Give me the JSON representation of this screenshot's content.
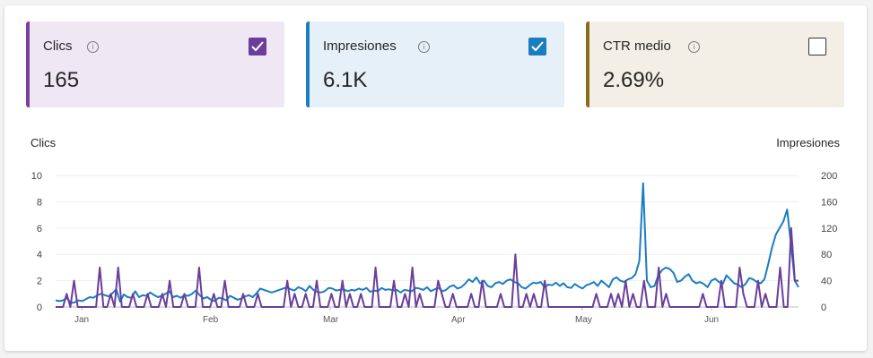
{
  "cards": [
    {
      "label": "Clics",
      "value": "165",
      "checked": true,
      "accent": "#7b3f9e",
      "bg": "#efe7f4",
      "check_color": "#6a3e9a"
    },
    {
      "label": "Impresiones",
      "value": "6.1K",
      "checked": true,
      "accent": "#1a7dc0",
      "bg": "#e6f0f9",
      "check_color": "#1a7dc0"
    },
    {
      "label": "CTR medio",
      "value": "2.69%",
      "checked": false,
      "accent": "#8a6d1a",
      "bg": "#f3efe6",
      "check_color": "#333333"
    }
  ],
  "info_glyph": "i",
  "chart_data": {
    "type": "line",
    "left_axis": {
      "title": "Clics",
      "ticks": [
        "0",
        "2",
        "4",
        "6",
        "8",
        "10"
      ],
      "range": [
        0,
        10
      ]
    },
    "right_axis": {
      "title": "Impresiones",
      "ticks": [
        "0",
        "40",
        "80",
        "120",
        "160",
        "200"
      ],
      "range": [
        0,
        200
      ]
    },
    "months": [
      "Jan",
      "Feb",
      "Mar",
      "Apr",
      "May",
      "Jun"
    ],
    "series": [
      {
        "name": "Impresiones",
        "axis": "right",
        "color": "#1a7dc0",
        "values": [
          10,
          9,
          10,
          14,
          6,
          7,
          10,
          9,
          12,
          15,
          14,
          18,
          20,
          18,
          16,
          21,
          27,
          8,
          19,
          15,
          14,
          24,
          15,
          18,
          17,
          22,
          18,
          15,
          17,
          20,
          24,
          15,
          17,
          14,
          18,
          17,
          20,
          25,
          18,
          13,
          15,
          11,
          9,
          14,
          13,
          10,
          17,
          14,
          11,
          13,
          16,
          18,
          15,
          21,
          28,
          26,
          24,
          22,
          24,
          26,
          28,
          30,
          27,
          25,
          30,
          28,
          24,
          32,
          26,
          23,
          22,
          24,
          29,
          28,
          25,
          26,
          27,
          24,
          26,
          25,
          28,
          26,
          29,
          23,
          25,
          24,
          29,
          26,
          27,
          25,
          26,
          22,
          26,
          25,
          24,
          29,
          28,
          26,
          30,
          24,
          27,
          29,
          24,
          26,
          31,
          33,
          28,
          30,
          35,
          42,
          38,
          45,
          36,
          40,
          32,
          30,
          36,
          38,
          35,
          40,
          42,
          38,
          36,
          30,
          28,
          33,
          37,
          36,
          38,
          30,
          34,
          33,
          37,
          32,
          36,
          30,
          29,
          35,
          31,
          28,
          33,
          35,
          38,
          32,
          40,
          35,
          30,
          42,
          45,
          40,
          38,
          42,
          44,
          50,
          70,
          188,
          40,
          30,
          32,
          48,
          56,
          60,
          58,
          52,
          38,
          40,
          46,
          50,
          40,
          36,
          38,
          35,
          30,
          40,
          43,
          38,
          35,
          48,
          42,
          36,
          34,
          30,
          35,
          44,
          42,
          38,
          36,
          42,
          65,
          90,
          110,
          120,
          130,
          148,
          95,
          40,
          30
        ]
      },
      {
        "name": "Clics",
        "axis": "left",
        "color": "#6a3e9a",
        "values": [
          0,
          0,
          0,
          1,
          0,
          2,
          0,
          0,
          0,
          0,
          0,
          0,
          3,
          0,
          0,
          1,
          0,
          3,
          0,
          0,
          0,
          1,
          0,
          0,
          0,
          1,
          0,
          0,
          0,
          1,
          0,
          2,
          0,
          0,
          0,
          1,
          0,
          0,
          0,
          3,
          0,
          0,
          0,
          1,
          0,
          0,
          2,
          0,
          0,
          0,
          0,
          1,
          0,
          0,
          0,
          1,
          0,
          0,
          0,
          0,
          0,
          0,
          0,
          2,
          0,
          1,
          0,
          0,
          1,
          0,
          0,
          2,
          0,
          0,
          0,
          1,
          0,
          0,
          2,
          0,
          1,
          0,
          0,
          1,
          0,
          0,
          0,
          3,
          0,
          0,
          0,
          0,
          2,
          0,
          0,
          1,
          0,
          3,
          0,
          1,
          0,
          0,
          0,
          0,
          2,
          1,
          0,
          0,
          1,
          0,
          0,
          0,
          0,
          1,
          0,
          0,
          2,
          0,
          0,
          0,
          0,
          1,
          0,
          0,
          0,
          4,
          0,
          0,
          1,
          0,
          1,
          0,
          0,
          2,
          0,
          0,
          0,
          0,
          0,
          0,
          0,
          0,
          0,
          0,
          0,
          0,
          0,
          1,
          0,
          0,
          0,
          1,
          0,
          1,
          0,
          2,
          0,
          1,
          0,
          0,
          2,
          0,
          0,
          0,
          3,
          0,
          1,
          0,
          0,
          0,
          0,
          0,
          0,
          0,
          0,
          0,
          1,
          0,
          0,
          0,
          0,
          2,
          0,
          0,
          0,
          0,
          3,
          1,
          0,
          0,
          0,
          2,
          0,
          1,
          0,
          0,
          0,
          3,
          0,
          0,
          6,
          2,
          2
        ]
      }
    ]
  }
}
